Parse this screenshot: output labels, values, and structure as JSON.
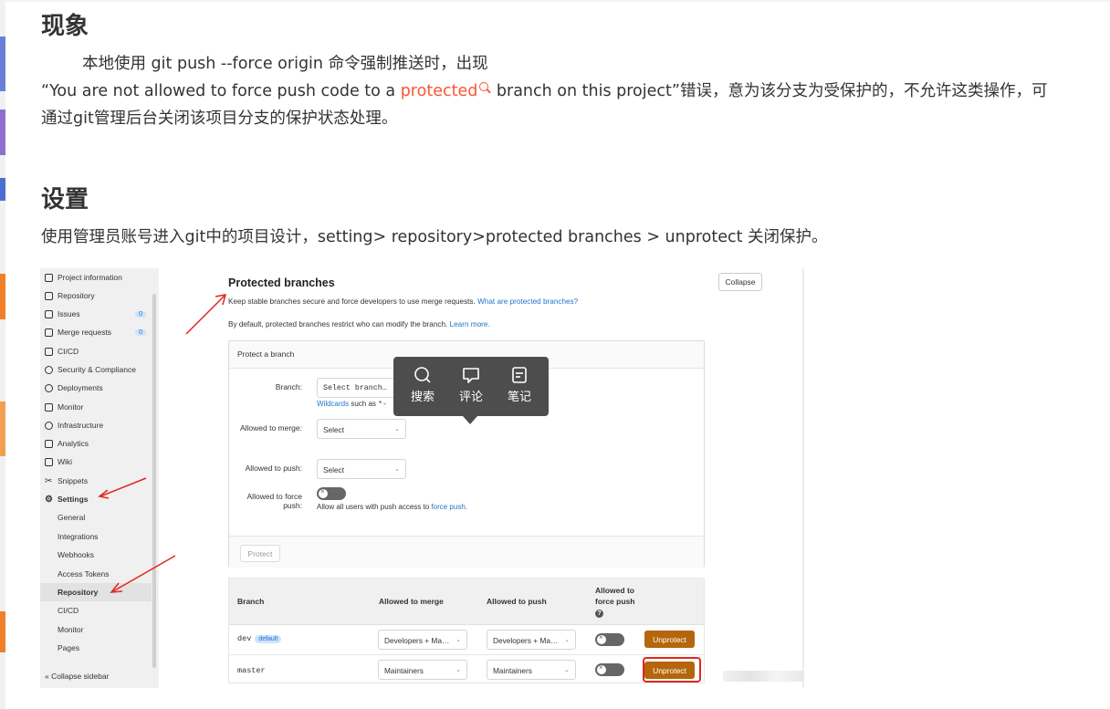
{
  "article": {
    "section1_title": "现象",
    "p1": "本地使用 git push --force origin 命令强制推送时，出现",
    "p2_before": "“You are not allowed to force push code to a ",
    "p2_keyword": "protected",
    "p2_after": " branch on this project”错误，意为该分支为受保护的，不允许这类操作，可",
    "p3": "通过git管理后台关闭该项目分支的保护状态处理。",
    "section2_title": "设置",
    "p4": "使用管理员账号进入git中的项目设计，setting> repository>protected branches > unprotect 关闭保护。"
  },
  "sidebar": {
    "items": [
      {
        "label": "Project information",
        "icon": "info-icon"
      },
      {
        "label": "Repository",
        "icon": "book-icon"
      },
      {
        "label": "Issues",
        "icon": "issues-icon",
        "badge": "0"
      },
      {
        "label": "Merge requests",
        "icon": "merge-request-icon",
        "badge": "0"
      },
      {
        "label": "CI/CD",
        "icon": "rocket-icon"
      },
      {
        "label": "Security & Compliance",
        "icon": "shield-icon"
      },
      {
        "label": "Deployments",
        "icon": "deployments-icon"
      },
      {
        "label": "Monitor",
        "icon": "monitor-icon"
      },
      {
        "label": "Infrastructure",
        "icon": "cloud-icon"
      },
      {
        "label": "Analytics",
        "icon": "chart-icon"
      },
      {
        "label": "Wiki",
        "icon": "wiki-icon"
      },
      {
        "label": "Snippets",
        "icon": "scissors-icon"
      },
      {
        "label": "Settings",
        "icon": "gear-icon"
      }
    ],
    "sub_items": [
      "General",
      "Integrations",
      "Webhooks",
      "Access Tokens",
      "Repository",
      "CI/CD",
      "Monitor",
      "Pages"
    ],
    "collapse_label": "Collapse sidebar"
  },
  "protected": {
    "title": "Protected branches",
    "desc": "Keep stable branches secure and force developers to use merge requests.",
    "desc_link": "What are protected branches?",
    "desc2": "By default, protected branches restrict who can modify the branch.",
    "desc2_link": "Learn more.",
    "collapse_btn": "Collapse",
    "form": {
      "header": "Protect a branch",
      "branch_label": "Branch:",
      "branch_placeholder": "Select branch…",
      "wildcards_link": "Wildcards",
      "wildcards_text": "such as",
      "merge_label": "Allowed to merge:",
      "merge_select": "Select",
      "push_label": "Allowed to push:",
      "push_select": "Select",
      "force_label": "Allowed to force push:",
      "force_hint": "Allow all users with push access to",
      "force_hint_link": "force push.",
      "protect_btn": "Protect"
    },
    "table": {
      "headers": [
        "Branch",
        "Allowed to merge",
        "Allowed to push",
        "Allowed to force push"
      ],
      "rows": [
        {
          "branch": "dev",
          "badge": "default",
          "merge": "Developers + Ma…",
          "push": "Developers + Ma…",
          "action": "Unprotect"
        },
        {
          "branch": "master",
          "merge": "Maintainers",
          "push": "Maintainers",
          "action": "Unprotect"
        }
      ]
    }
  },
  "popup": {
    "items": [
      {
        "label": "搜索",
        "icon": "search-icon"
      },
      {
        "label": "评论",
        "icon": "comment-icon"
      },
      {
        "label": "笔记",
        "icon": "note-icon"
      }
    ]
  },
  "colors": {
    "keyword": "#fc5531",
    "unprotect": "#b5650b",
    "highlight": "#e0271e",
    "link": "#1f75cb"
  }
}
